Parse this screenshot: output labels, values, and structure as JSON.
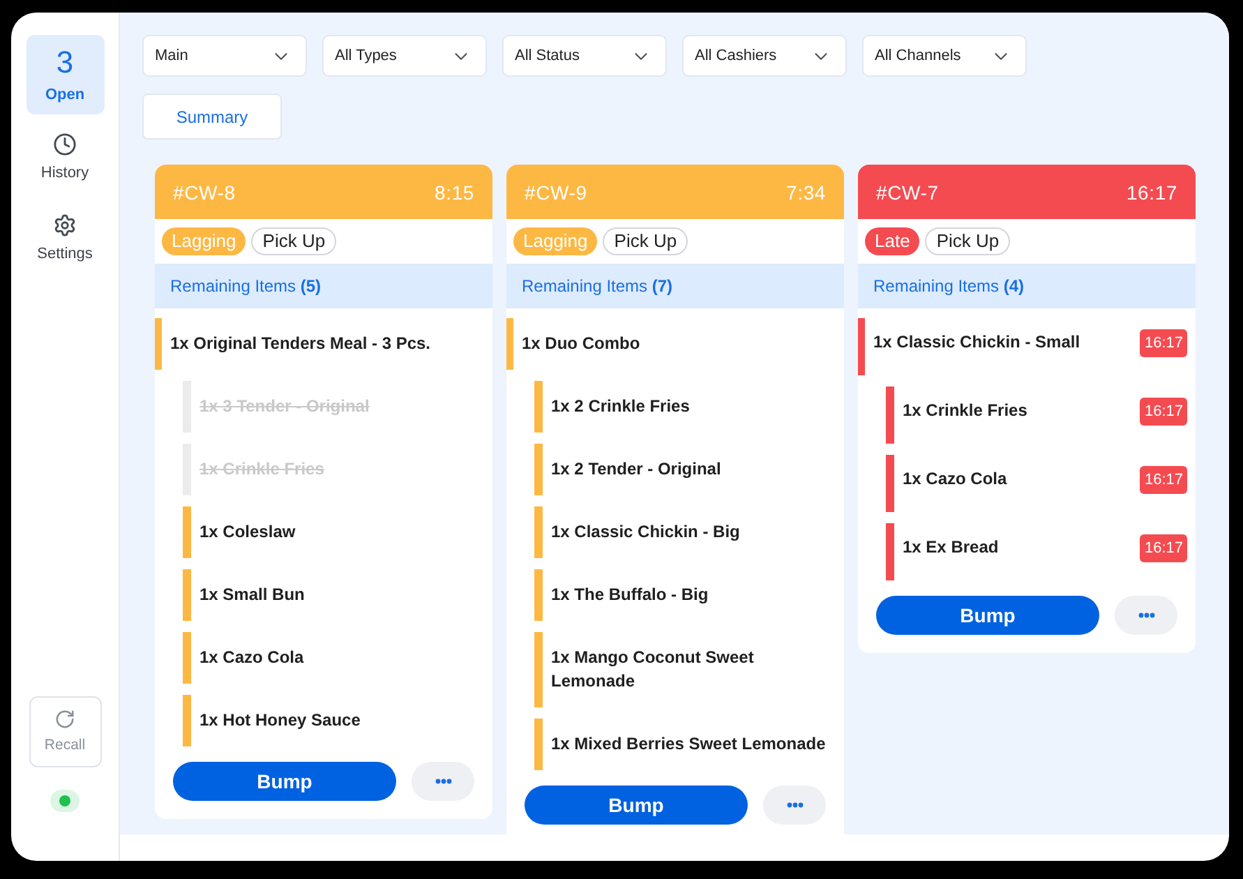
{
  "sidebar": {
    "items": [
      {
        "kind": "count",
        "count": "3",
        "label": "Open",
        "selected": true
      },
      {
        "kind": "history",
        "label": "History",
        "selected": false
      },
      {
        "kind": "settings",
        "label": "Settings",
        "selected": false
      }
    ],
    "recall": "Recall",
    "connection": {
      "online": true
    }
  },
  "filters": [
    {
      "value": "Main"
    },
    {
      "value": "All Types"
    },
    {
      "value": "All Status"
    },
    {
      "value": "All Cashiers"
    },
    {
      "value": "All Channels"
    }
  ],
  "summary_button": "Summary",
  "orders": [
    {
      "id": "#CW-8",
      "elapsed": "8:15",
      "color": "#fdb844",
      "tags": [
        {
          "kind": "status",
          "label": "Lagging"
        },
        {
          "kind": "channel",
          "label": "Pick Up"
        }
      ],
      "remaining": "Remaining Items **(5)**",
      "items": [
        {
          "text": "1x Original Tenders Meal - 3 Pcs.",
          "done": false,
          "children": [
            {
              "text": "1x 3 Tender - Original",
              "done": true
            },
            {
              "text": "1x Crinkle Fries",
              "done": true
            },
            {
              "text": "1x Coleslaw",
              "done": false
            },
            {
              "text": "1x Small Bun",
              "done": false
            },
            {
              "text": "1x Cazo Cola",
              "done": false
            },
            {
              "text": "1x Hot Honey Sauce",
              "done": false
            }
          ]
        }
      ],
      "bump": "Bump"
    },
    {
      "id": "#CW-9",
      "elapsed": "7:34",
      "color": "#fdb844",
      "tags": [
        {
          "kind": "status",
          "label": "Lagging"
        },
        {
          "kind": "channel",
          "label": "Pick Up"
        }
      ],
      "remaining": "Remaining Items **(7)**",
      "items": [
        {
          "text": "1x Duo Combo",
          "done": false,
          "children": [
            {
              "text": "1x 2 Crinkle Fries",
              "done": false
            },
            {
              "text": "1x 2 Tender - Original",
              "done": false
            },
            {
              "text": "1x Classic Chickin - Big",
              "done": false
            },
            {
              "text": "1x The Buffalo - Big",
              "done": false
            },
            {
              "text": "1x Mango Coconut Sweet Lemonade",
              "done": false
            },
            {
              "text": "1x Mixed Berries Sweet Lemonade",
              "done": false
            }
          ]
        }
      ],
      "bump": "Bump"
    },
    {
      "id": "#CW-7",
      "elapsed": "16:17",
      "color": "#f44b51",
      "tags": [
        {
          "kind": "status",
          "label": "Late"
        },
        {
          "kind": "channel",
          "label": "Pick Up"
        }
      ],
      "remaining": "Remaining Items **(4)**",
      "items": [
        {
          "text": "1x Classic Chickin - Small",
          "done": false,
          "timer": "16:17",
          "children": [
            {
              "text": "1x Crinkle Fries",
              "done": false,
              "timer": "16:17"
            },
            {
              "text": "1x Cazo Cola",
              "done": false,
              "timer": "16:17"
            },
            {
              "text": "1x Ex Bread",
              "done": false,
              "timer": "16:17"
            }
          ]
        }
      ],
      "bump": "Bump"
    }
  ]
}
